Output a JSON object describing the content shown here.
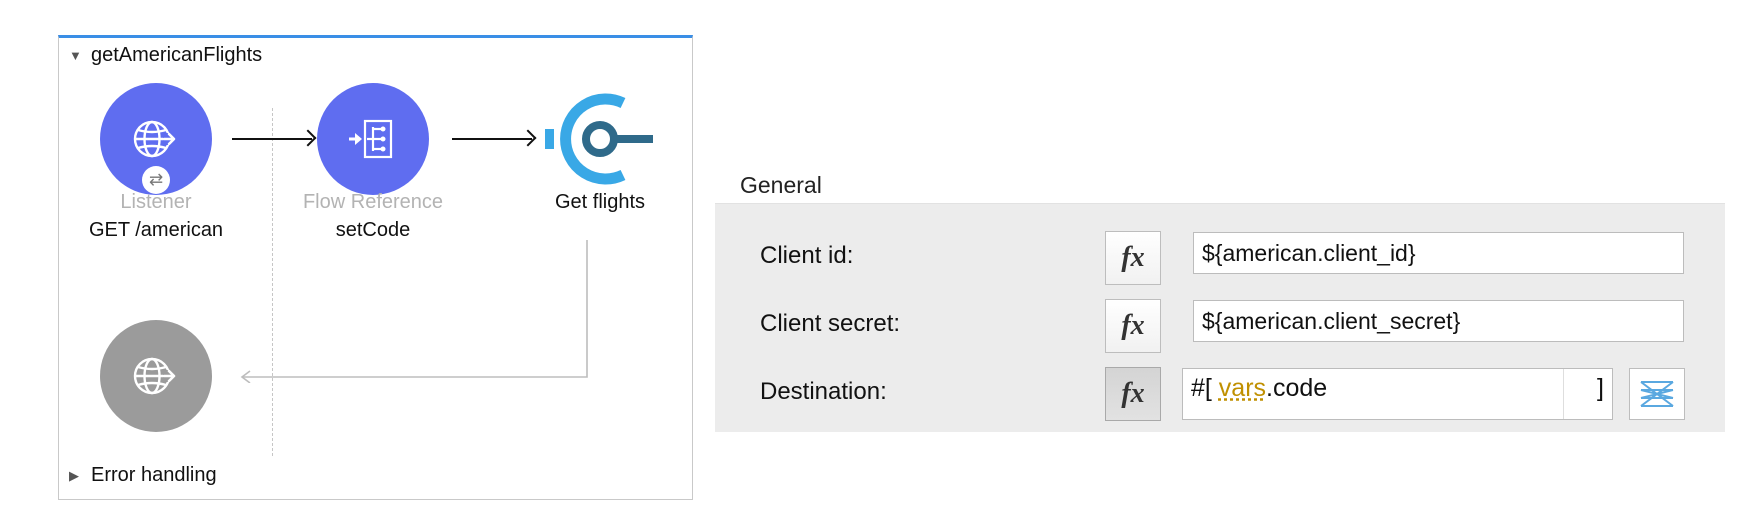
{
  "flow": {
    "name": "getAmericanFlights",
    "expanded_icon": "triangle-down-icon",
    "nodes": [
      {
        "type": "Listener",
        "label": "GET /american",
        "icon": "globe-listener-icon"
      },
      {
        "type": "Flow Reference",
        "label": "setCode",
        "icon": "flow-reference-icon"
      },
      {
        "type": "",
        "label": "Get flights",
        "icon": "connector-icon"
      }
    ],
    "response_icon": "globe-response-icon",
    "badge_icon": "exchange-arrows-icon",
    "error_handling": {
      "label": "Error handling",
      "icon": "triangle-right-icon"
    }
  },
  "properties": {
    "section_title": "General",
    "fields": [
      {
        "label": "Client id:",
        "value": "${american.client_id}",
        "fx_icon": "fx"
      },
      {
        "label": "Client secret:",
        "value": "${american.client_secret}",
        "fx_icon": "fx"
      }
    ],
    "destination": {
      "label": "Destination:",
      "fx_icon": "fx",
      "expr_open": "#[ ",
      "expr_keyword": "vars",
      "expr_rest": ".code",
      "expr_close": "]",
      "mapper_icon": "data-mapper-icon"
    }
  },
  "colors": {
    "node_blue": "#5f6df0",
    "node_gray": "#9b9b9b",
    "connector_blue": "#39a8e6",
    "connector_dark": "#2f6a8a",
    "flow_border": "#3a8ee6",
    "keyword": "#c09000"
  }
}
